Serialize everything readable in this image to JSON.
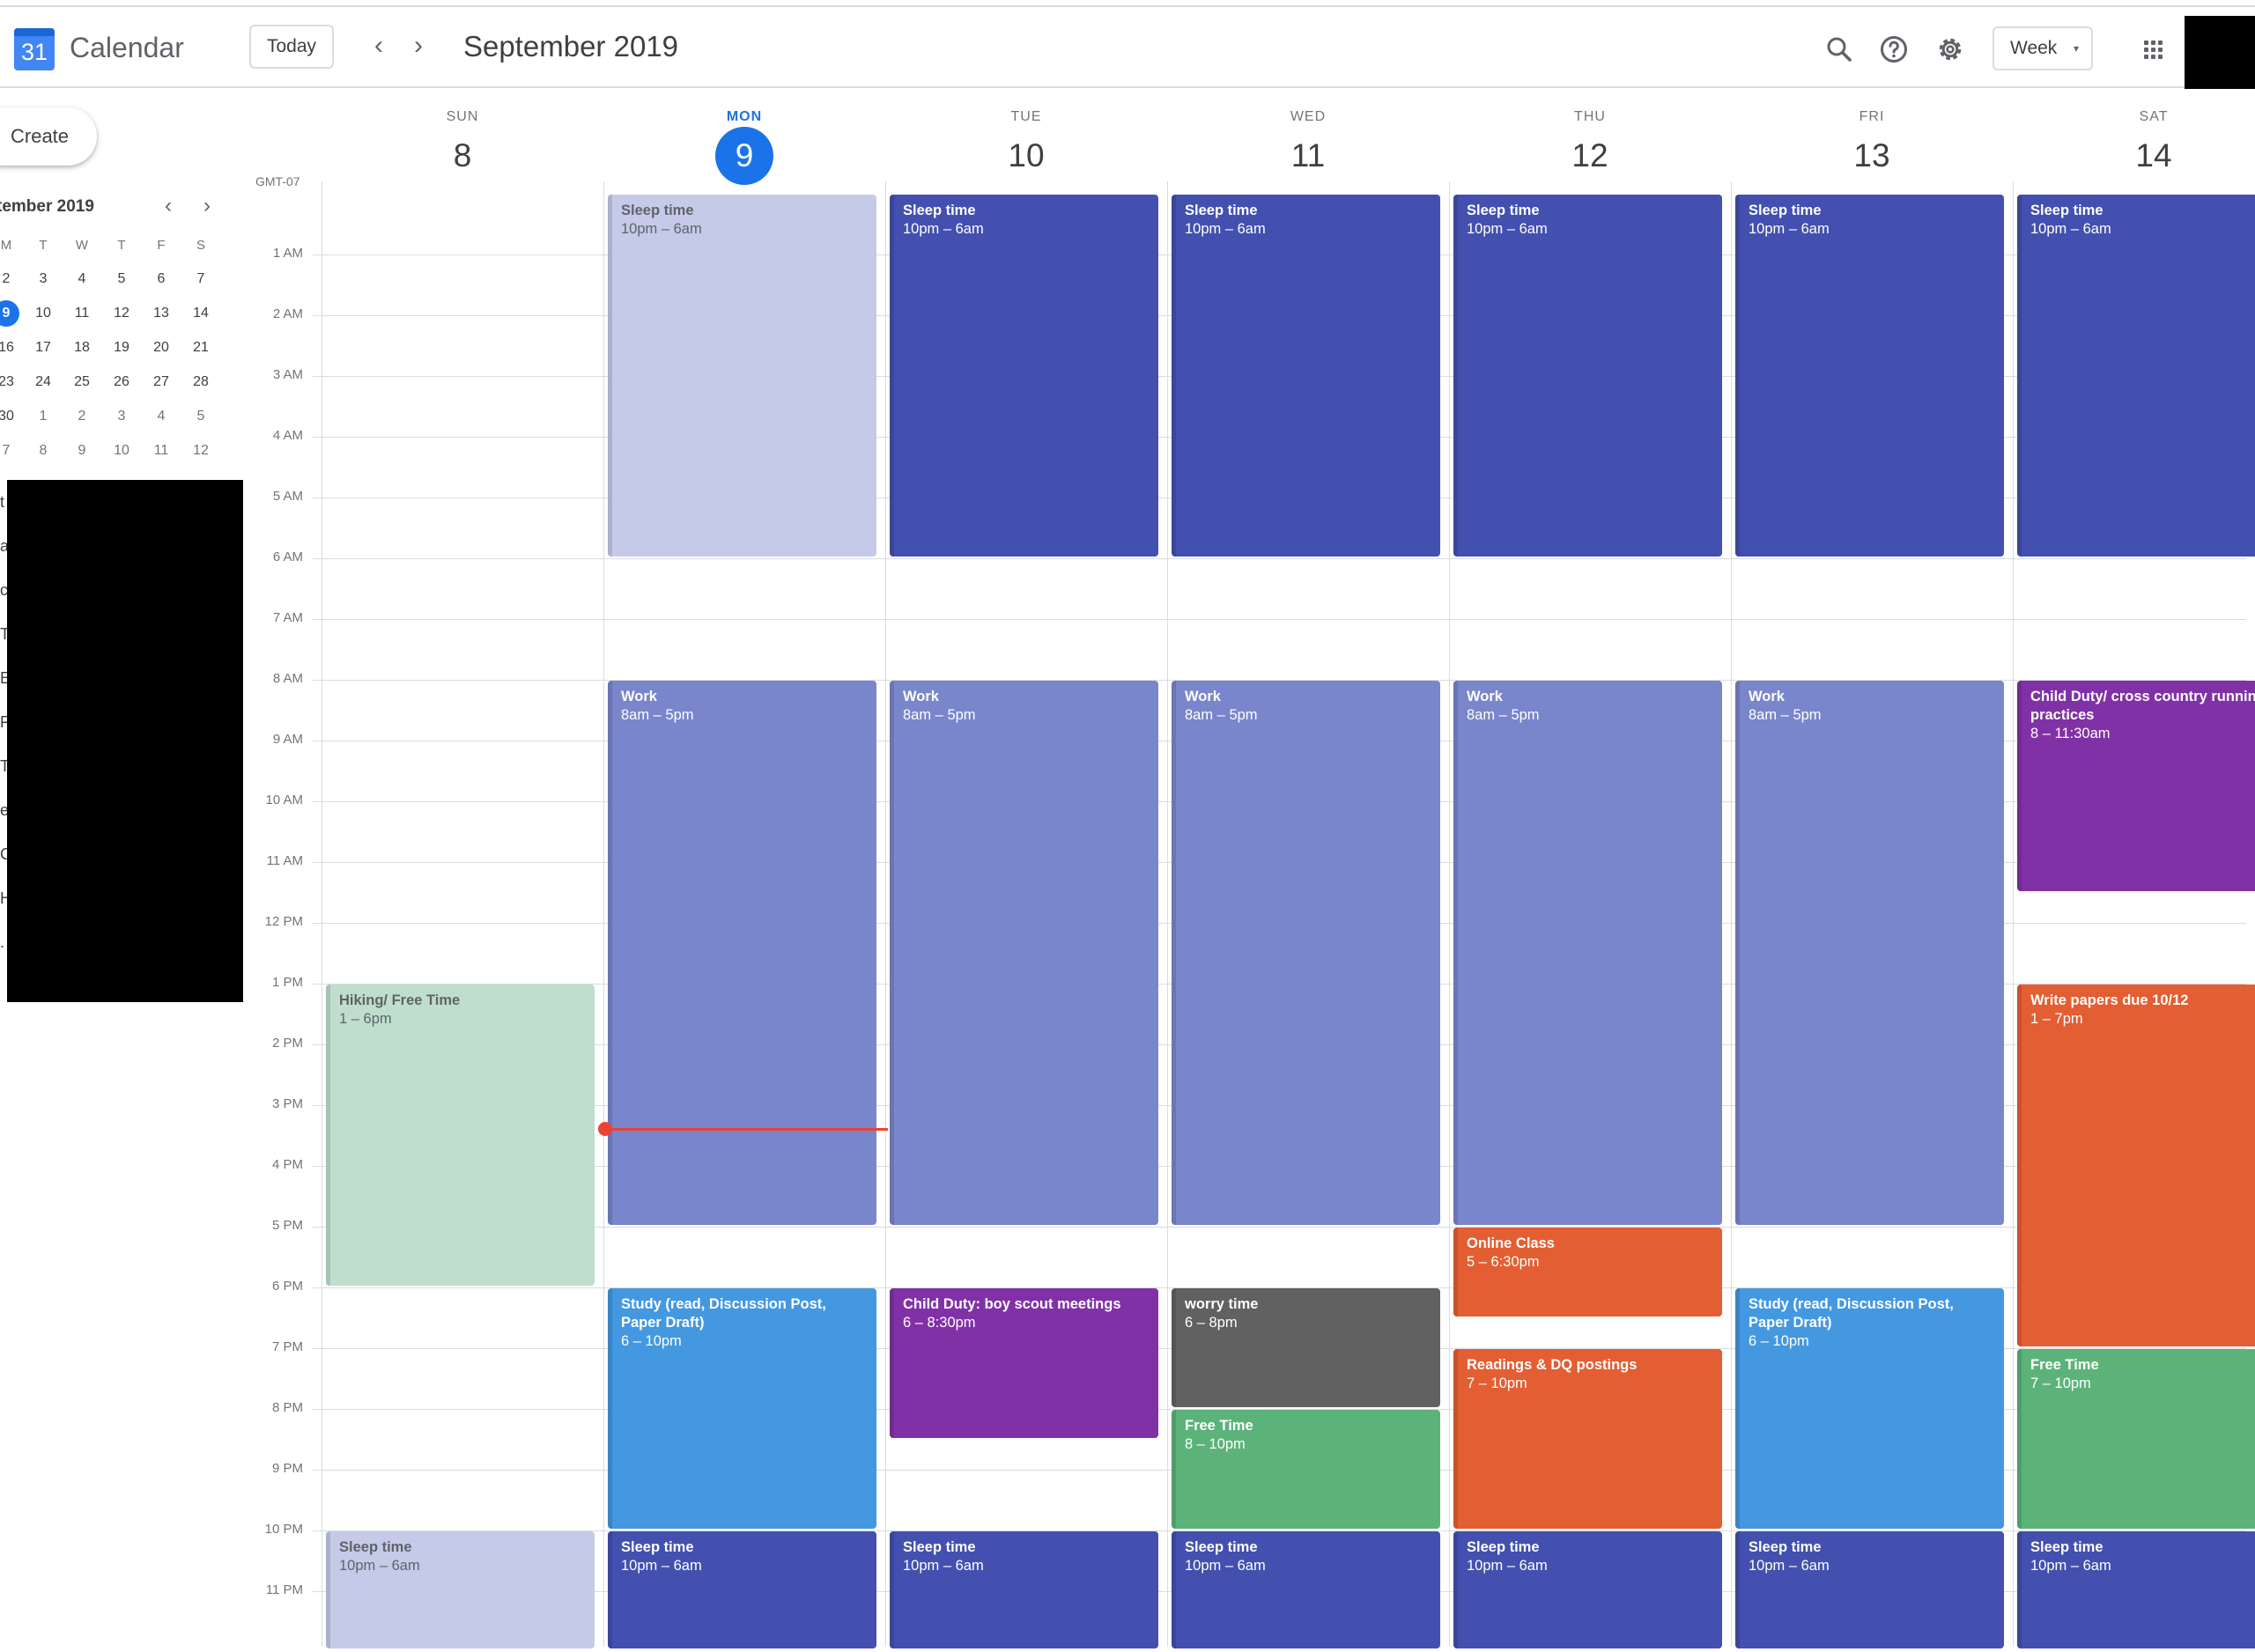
{
  "header": {
    "logo_text": "31",
    "app_title": "Calendar",
    "today_label": "Today",
    "prev_label": "‹",
    "next_label": "›",
    "month_title": "September 2019",
    "view_label": "Week",
    "view_caret": "▾",
    "icons": [
      "search-icon",
      "help-icon",
      "settings-icon",
      "apps-icon"
    ]
  },
  "sidebar": {
    "create_label": "Create",
    "mini_title": "tember 2019",
    "prev_label": "‹",
    "next_label": "›",
    "dow": [
      "M",
      "T",
      "W",
      "T",
      "F",
      "S"
    ],
    "weeks": [
      [
        "2",
        "3",
        "4",
        "5",
        "6",
        "7"
      ],
      [
        "9",
        "10",
        "11",
        "12",
        "13",
        "14"
      ],
      [
        "16",
        "17",
        "18",
        "19",
        "20",
        "21"
      ],
      [
        "23",
        "24",
        "25",
        "26",
        "27",
        "28"
      ],
      [
        "30",
        "1",
        "2",
        "3",
        "4",
        "5"
      ],
      [
        "7",
        "8",
        "9",
        "10",
        "11",
        "12"
      ]
    ],
    "selected_day": "9",
    "slivers": [
      "t",
      "a",
      "c",
      "T",
      "E",
      "F",
      "T",
      "e",
      "C",
      "H",
      "."
    ]
  },
  "timezone": "GMT-07",
  "days": [
    {
      "dow": "SUN",
      "num": "8"
    },
    {
      "dow": "MON",
      "num": "9",
      "today": true
    },
    {
      "dow": "TUE",
      "num": "10"
    },
    {
      "dow": "WED",
      "num": "11"
    },
    {
      "dow": "THU",
      "num": "12"
    },
    {
      "dow": "FRI",
      "num": "13"
    },
    {
      "dow": "SAT",
      "num": "14"
    }
  ],
  "hours": [
    "1 AM",
    "2 AM",
    "3 AM",
    "4 AM",
    "5 AM",
    "6 AM",
    "7 AM",
    "8 AM",
    "9 AM",
    "10 AM",
    "11 AM",
    "12 PM",
    "1 PM",
    "2 PM",
    "3 PM",
    "4 PM",
    "5 PM",
    "6 PM",
    "7 PM",
    "8 PM",
    "9 PM",
    "10 PM",
    "11 PM"
  ],
  "colors": {
    "sleep_dark": "#4350af",
    "sleep_pale": "#c5cae9",
    "work": "#7986cb",
    "hiking": "#bfdecd",
    "study": "#4498e0",
    "child_purple": "#8131a6",
    "worry_gray": "#616161",
    "free_green": "#5cb37a",
    "tomato": "#e35e32",
    "accent": "#1a73e8",
    "now_red": "#ea4335"
  },
  "events": [
    {
      "day": 0,
      "title": "Hiking/ Free Time",
      "time": "1 – 6pm",
      "start": 13,
      "end": 18,
      "color": "hiking",
      "pale": true
    },
    {
      "day": 0,
      "title": "Sleep time",
      "time": "10pm – 6am",
      "start": 22,
      "end": 24,
      "color": "sleep_pale",
      "pale": true
    },
    {
      "day": 1,
      "title": "Sleep time",
      "time": "10pm – 6am",
      "start": 0,
      "end": 6,
      "color": "sleep_pale",
      "pale": true
    },
    {
      "day": 1,
      "title": "Work",
      "time": "8am – 5pm",
      "start": 8,
      "end": 17,
      "color": "work"
    },
    {
      "day": 1,
      "title": "Study (read, Discussion Post, Paper Draft)",
      "time": "6 – 10pm",
      "start": 18,
      "end": 22,
      "color": "study"
    },
    {
      "day": 1,
      "title": "Sleep time",
      "time": "10pm – 6am",
      "start": 22,
      "end": 24,
      "color": "sleep_dark"
    },
    {
      "day": 2,
      "title": "Sleep time",
      "time": "10pm – 6am",
      "start": 0,
      "end": 6,
      "color": "sleep_dark"
    },
    {
      "day": 2,
      "title": "Work",
      "time": "8am – 5pm",
      "start": 8,
      "end": 17,
      "color": "work"
    },
    {
      "day": 2,
      "title": "Child Duty: boy scout meetings",
      "time": "6 – 8:30pm",
      "start": 18,
      "end": 20.5,
      "color": "child_purple"
    },
    {
      "day": 2,
      "title": "Sleep time",
      "time": "10pm – 6am",
      "start": 22,
      "end": 24,
      "color": "sleep_dark"
    },
    {
      "day": 3,
      "title": "Sleep time",
      "time": "10pm – 6am",
      "start": 0,
      "end": 6,
      "color": "sleep_dark"
    },
    {
      "day": 3,
      "title": "Work",
      "time": "8am – 5pm",
      "start": 8,
      "end": 17,
      "color": "work"
    },
    {
      "day": 3,
      "title": "worry time",
      "time": "6 – 8pm",
      "start": 18,
      "end": 20,
      "color": "worry_gray"
    },
    {
      "day": 3,
      "title": "Free Time",
      "time": "8 – 10pm",
      "start": 20,
      "end": 22,
      "color": "free_green"
    },
    {
      "day": 3,
      "title": "Sleep time",
      "time": "10pm – 6am",
      "start": 22,
      "end": 24,
      "color": "sleep_dark"
    },
    {
      "day": 4,
      "title": "Sleep time",
      "time": "10pm – 6am",
      "start": 0,
      "end": 6,
      "color": "sleep_dark"
    },
    {
      "day": 4,
      "title": "Work",
      "time": "8am – 5pm",
      "start": 8,
      "end": 17,
      "color": "work"
    },
    {
      "day": 4,
      "title": "Online Class",
      "time": "5 – 6:30pm",
      "start": 17,
      "end": 18.5,
      "color": "tomato"
    },
    {
      "day": 4,
      "title": "Readings & DQ postings",
      "time": "7 – 10pm",
      "start": 19,
      "end": 22,
      "color": "tomato"
    },
    {
      "day": 4,
      "title": "Sleep time",
      "time": "10pm – 6am",
      "start": 22,
      "end": 24,
      "color": "sleep_dark"
    },
    {
      "day": 5,
      "title": "Sleep time",
      "time": "10pm – 6am",
      "start": 0,
      "end": 6,
      "color": "sleep_dark"
    },
    {
      "day": 5,
      "title": "Work",
      "time": "8am – 5pm",
      "start": 8,
      "end": 17,
      "color": "work"
    },
    {
      "day": 5,
      "title": "Study (read, Discussion Post, Paper Draft)",
      "time": "6 – 10pm",
      "start": 18,
      "end": 22,
      "color": "study"
    },
    {
      "day": 5,
      "title": "Sleep time",
      "time": "10pm – 6am",
      "start": 22,
      "end": 24,
      "color": "sleep_dark"
    },
    {
      "day": 6,
      "title": "Sleep time",
      "time": "10pm – 6am",
      "start": 0,
      "end": 6,
      "color": "sleep_dark"
    },
    {
      "day": 6,
      "title": "Child Duty/ cross country running practices",
      "time": "8 – 11:30am",
      "start": 8,
      "end": 11.5,
      "color": "child_purple"
    },
    {
      "day": 6,
      "title": "Write papers due 10/12",
      "time": "1 – 7pm",
      "start": 13,
      "end": 19,
      "color": "tomato"
    },
    {
      "day": 6,
      "title": "Free Time",
      "time": "7 – 10pm",
      "start": 19,
      "end": 22,
      "color": "free_green"
    },
    {
      "day": 6,
      "title": "Sleep time",
      "time": "10pm – 6am",
      "start": 22,
      "end": 24,
      "color": "sleep_dark"
    }
  ],
  "current_time_hour": 15.5
}
